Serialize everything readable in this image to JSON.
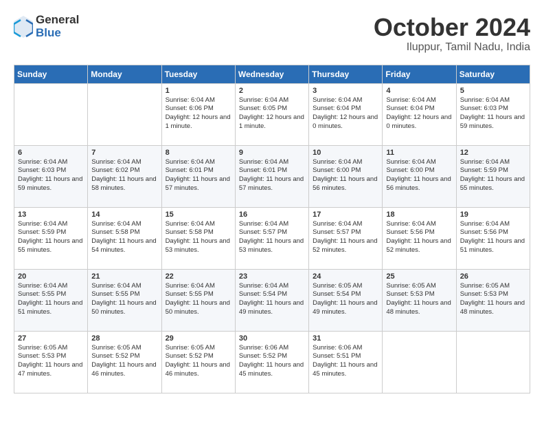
{
  "header": {
    "logo_general": "General",
    "logo_blue": "Blue",
    "month": "October 2024",
    "location": "Iluppur, Tamil Nadu, India"
  },
  "columns": [
    "Sunday",
    "Monday",
    "Tuesday",
    "Wednesday",
    "Thursday",
    "Friday",
    "Saturday"
  ],
  "weeks": [
    [
      {
        "day": "",
        "empty": true
      },
      {
        "day": "",
        "empty": true
      },
      {
        "day": "1",
        "sunrise": "6:04 AM",
        "sunset": "6:06 PM",
        "daylight": "12 hours and 1 minute."
      },
      {
        "day": "2",
        "sunrise": "6:04 AM",
        "sunset": "6:05 PM",
        "daylight": "12 hours and 1 minute."
      },
      {
        "day": "3",
        "sunrise": "6:04 AM",
        "sunset": "6:04 PM",
        "daylight": "12 hours and 0 minutes."
      },
      {
        "day": "4",
        "sunrise": "6:04 AM",
        "sunset": "6:04 PM",
        "daylight": "12 hours and 0 minutes."
      },
      {
        "day": "5",
        "sunrise": "6:04 AM",
        "sunset": "6:03 PM",
        "daylight": "11 hours and 59 minutes."
      }
    ],
    [
      {
        "day": "6",
        "sunrise": "6:04 AM",
        "sunset": "6:03 PM",
        "daylight": "11 hours and 59 minutes."
      },
      {
        "day": "7",
        "sunrise": "6:04 AM",
        "sunset": "6:02 PM",
        "daylight": "11 hours and 58 minutes."
      },
      {
        "day": "8",
        "sunrise": "6:04 AM",
        "sunset": "6:01 PM",
        "daylight": "11 hours and 57 minutes."
      },
      {
        "day": "9",
        "sunrise": "6:04 AM",
        "sunset": "6:01 PM",
        "daylight": "11 hours and 57 minutes."
      },
      {
        "day": "10",
        "sunrise": "6:04 AM",
        "sunset": "6:00 PM",
        "daylight": "11 hours and 56 minutes."
      },
      {
        "day": "11",
        "sunrise": "6:04 AM",
        "sunset": "6:00 PM",
        "daylight": "11 hours and 56 minutes."
      },
      {
        "day": "12",
        "sunrise": "6:04 AM",
        "sunset": "5:59 PM",
        "daylight": "11 hours and 55 minutes."
      }
    ],
    [
      {
        "day": "13",
        "sunrise": "6:04 AM",
        "sunset": "5:59 PM",
        "daylight": "11 hours and 55 minutes."
      },
      {
        "day": "14",
        "sunrise": "6:04 AM",
        "sunset": "5:58 PM",
        "daylight": "11 hours and 54 minutes."
      },
      {
        "day": "15",
        "sunrise": "6:04 AM",
        "sunset": "5:58 PM",
        "daylight": "11 hours and 53 minutes."
      },
      {
        "day": "16",
        "sunrise": "6:04 AM",
        "sunset": "5:57 PM",
        "daylight": "11 hours and 53 minutes."
      },
      {
        "day": "17",
        "sunrise": "6:04 AM",
        "sunset": "5:57 PM",
        "daylight": "11 hours and 52 minutes."
      },
      {
        "day": "18",
        "sunrise": "6:04 AM",
        "sunset": "5:56 PM",
        "daylight": "11 hours and 52 minutes."
      },
      {
        "day": "19",
        "sunrise": "6:04 AM",
        "sunset": "5:56 PM",
        "daylight": "11 hours and 51 minutes."
      }
    ],
    [
      {
        "day": "20",
        "sunrise": "6:04 AM",
        "sunset": "5:55 PM",
        "daylight": "11 hours and 51 minutes."
      },
      {
        "day": "21",
        "sunrise": "6:04 AM",
        "sunset": "5:55 PM",
        "daylight": "11 hours and 50 minutes."
      },
      {
        "day": "22",
        "sunrise": "6:04 AM",
        "sunset": "5:55 PM",
        "daylight": "11 hours and 50 minutes."
      },
      {
        "day": "23",
        "sunrise": "6:04 AM",
        "sunset": "5:54 PM",
        "daylight": "11 hours and 49 minutes."
      },
      {
        "day": "24",
        "sunrise": "6:05 AM",
        "sunset": "5:54 PM",
        "daylight": "11 hours and 49 minutes."
      },
      {
        "day": "25",
        "sunrise": "6:05 AM",
        "sunset": "5:53 PM",
        "daylight": "11 hours and 48 minutes."
      },
      {
        "day": "26",
        "sunrise": "6:05 AM",
        "sunset": "5:53 PM",
        "daylight": "11 hours and 48 minutes."
      }
    ],
    [
      {
        "day": "27",
        "sunrise": "6:05 AM",
        "sunset": "5:53 PM",
        "daylight": "11 hours and 47 minutes."
      },
      {
        "day": "28",
        "sunrise": "6:05 AM",
        "sunset": "5:52 PM",
        "daylight": "11 hours and 46 minutes."
      },
      {
        "day": "29",
        "sunrise": "6:05 AM",
        "sunset": "5:52 PM",
        "daylight": "11 hours and 46 minutes."
      },
      {
        "day": "30",
        "sunrise": "6:06 AM",
        "sunset": "5:52 PM",
        "daylight": "11 hours and 45 minutes."
      },
      {
        "day": "31",
        "sunrise": "6:06 AM",
        "sunset": "5:51 PM",
        "daylight": "11 hours and 45 minutes."
      },
      {
        "day": "",
        "empty": true
      },
      {
        "day": "",
        "empty": true
      }
    ]
  ]
}
